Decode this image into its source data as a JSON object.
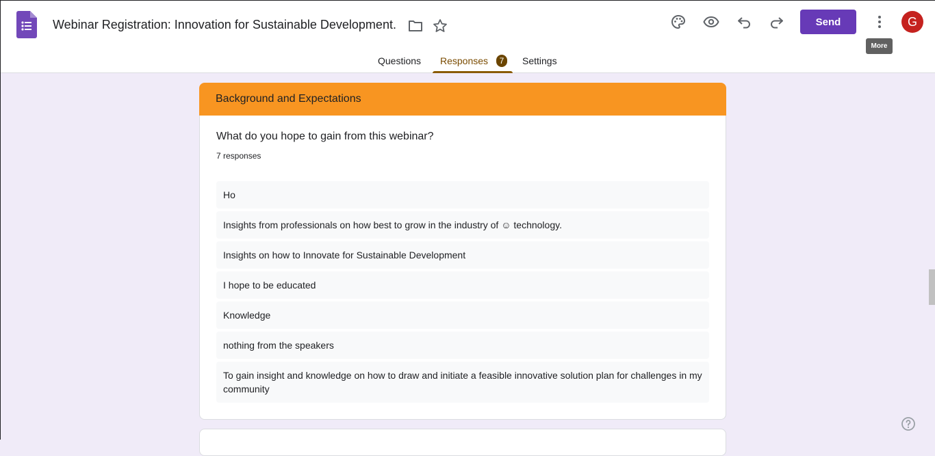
{
  "header": {
    "title": "Webinar Registration: Innovation for Sustainable Development.",
    "send_label": "Send",
    "more_tooltip": "More",
    "avatar_letter": "G",
    "accent_color": "#673ab7"
  },
  "tabs": [
    {
      "label": "Questions"
    },
    {
      "label": "Responses",
      "badge": "7",
      "active": true
    },
    {
      "label": "Settings"
    }
  ],
  "section": {
    "title": "Background and Expectations",
    "color": "#f89521"
  },
  "question": {
    "text": "What do you hope to gain from this webinar?",
    "count_label": "7 responses",
    "responses": [
      "Ho",
      "Insights from professionals on how best to grow in the industry of ☺ technology.",
      "Insights on how to Innovate for Sustainable Development",
      "I hope to be educated",
      "Knowledge",
      "nothing from the speakers",
      "To gain insight and knowledge on how to draw and initiate a feasible innovative solution plan for challenges in my community"
    ]
  }
}
